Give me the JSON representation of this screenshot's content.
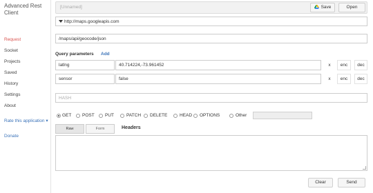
{
  "app": {
    "title": "Advanced Rest Client"
  },
  "sidebar": {
    "items": [
      {
        "label": "Request",
        "active": true
      },
      {
        "label": "Socket",
        "active": false
      },
      {
        "label": "Projects",
        "active": false
      },
      {
        "label": "Saved",
        "active": false
      },
      {
        "label": "History",
        "active": false
      },
      {
        "label": "Settings",
        "active": false
      },
      {
        "label": "About",
        "active": false
      }
    ],
    "rate_label": "Rate this application ▾",
    "donate_label": "Donate"
  },
  "toolbar": {
    "project_name": "[Unnamed]",
    "save_label": "Save",
    "open_label": "Open"
  },
  "request": {
    "url_value": "http://maps.googleapis.com",
    "path_value": "/maps/api/geocode/json",
    "query_title": "Query parameters",
    "add_label": "Add",
    "params": [
      {
        "name": "latlng",
        "value": "40.714224,-73.961452",
        "x": "x",
        "enc": "enc",
        "dec": "dec"
      },
      {
        "name": "sensor",
        "value": "false",
        "x": "x",
        "enc": "enc",
        "dec": "dec"
      }
    ],
    "hash_placeholder": "HASH",
    "methods": [
      {
        "label": "GET",
        "checked": true
      },
      {
        "label": "POST",
        "checked": false
      },
      {
        "label": "PUT",
        "checked": false
      },
      {
        "label": "PATCH",
        "checked": false
      },
      {
        "label": "DELETE",
        "checked": false
      },
      {
        "label": "HEAD",
        "checked": false
      },
      {
        "label": "OPTIONS",
        "checked": false
      },
      {
        "label": "Other",
        "checked": false
      }
    ],
    "tabs": {
      "raw": "Raw",
      "form": "Form"
    },
    "headers_label": "Headers"
  },
  "actions": {
    "clear_label": "Clear",
    "send_label": "Send"
  },
  "colors": {
    "accent_link": "#3b73b9",
    "active_nav": "#d9534f"
  }
}
